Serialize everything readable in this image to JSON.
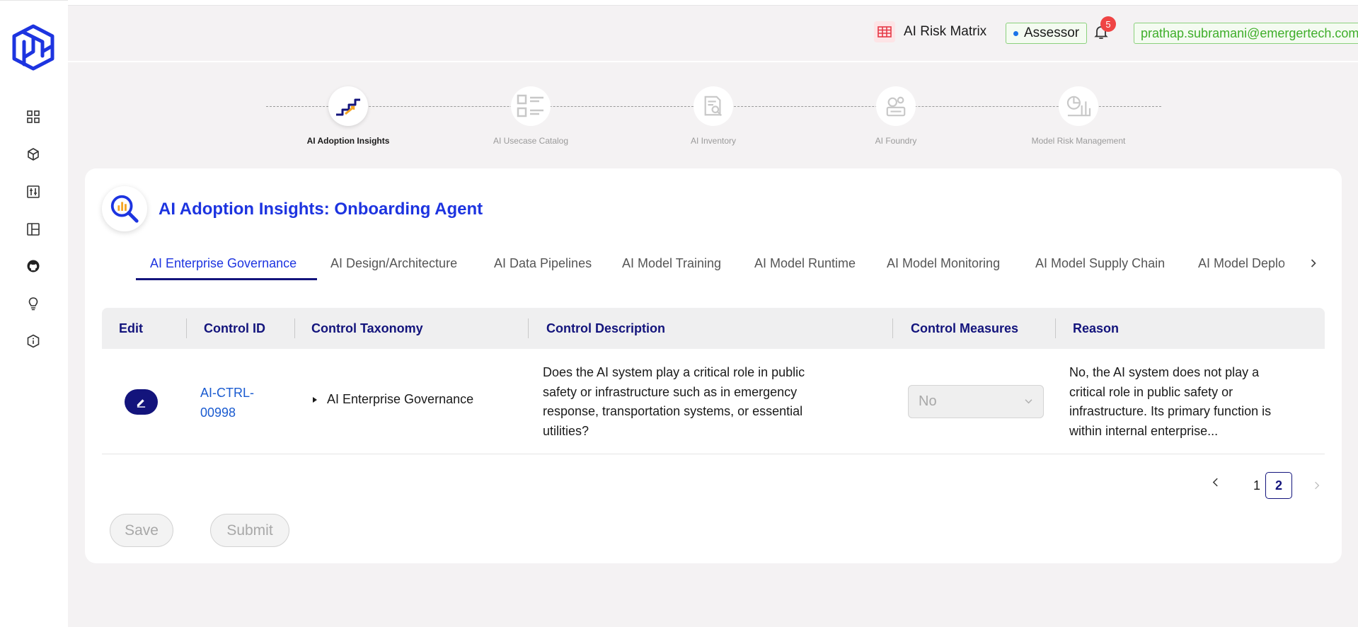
{
  "header": {
    "risk_matrix_label": "AI Risk Matrix",
    "role": "Assessor",
    "notification_count": "5",
    "user_email": "prathap.subramani@emergertech.com"
  },
  "sidebar": {
    "items": [
      {
        "icon": "dashboard-icon"
      },
      {
        "icon": "cube-icon"
      },
      {
        "icon": "sliders-icon"
      },
      {
        "icon": "layout-icon"
      },
      {
        "icon": "github-icon"
      },
      {
        "icon": "lightbulb-icon"
      },
      {
        "icon": "info-shield-icon"
      }
    ]
  },
  "stepper": [
    {
      "label": "AI Adoption Insights",
      "active": true
    },
    {
      "label": "AI Usecase Catalog",
      "active": false
    },
    {
      "label": "AI Inventory",
      "active": false
    },
    {
      "label": "AI Foundry",
      "active": false
    },
    {
      "label": "Model Risk Management",
      "active": false
    }
  ],
  "page": {
    "title": "AI Adoption Insights: Onboarding Agent"
  },
  "tabs": [
    {
      "label": "AI Enterprise Governance",
      "active": true
    },
    {
      "label": "AI Design/Architecture",
      "active": false
    },
    {
      "label": "AI Data Pipelines",
      "active": false
    },
    {
      "label": "AI Model Training",
      "active": false
    },
    {
      "label": "AI Model Runtime",
      "active": false
    },
    {
      "label": "AI Model Monitoring",
      "active": false
    },
    {
      "label": "AI Model Supply Chain",
      "active": false
    },
    {
      "label": "AI Model Deplo",
      "active": false
    }
  ],
  "table": {
    "columns": [
      "Edit",
      "Control ID",
      "Control Taxonomy",
      "Control Description",
      "Control Measures",
      "Reason"
    ],
    "rows": [
      {
        "control_id": "AI-CTRL-00998",
        "taxonomy": "AI Enterprise Governance",
        "description": "Does the AI system play a critical role in public safety or infrastructure such as in emergency response, transportation systems, or essential utilities?",
        "measure": "No",
        "reason": "No, the AI system does not play a critical role in public safety or infrastructure. Its primary function is within internal enterprise..."
      }
    ]
  },
  "pagination": {
    "pages": [
      "1",
      "2"
    ],
    "current": "2"
  },
  "actions": {
    "save_label": "Save",
    "submit_label": "Submit"
  },
  "colors": {
    "primary": "#13147c",
    "accent_blue": "#1d34e0",
    "link_blue": "#1a5bd0",
    "success_green": "#3fae2a",
    "badge_red": "#ef4444"
  }
}
